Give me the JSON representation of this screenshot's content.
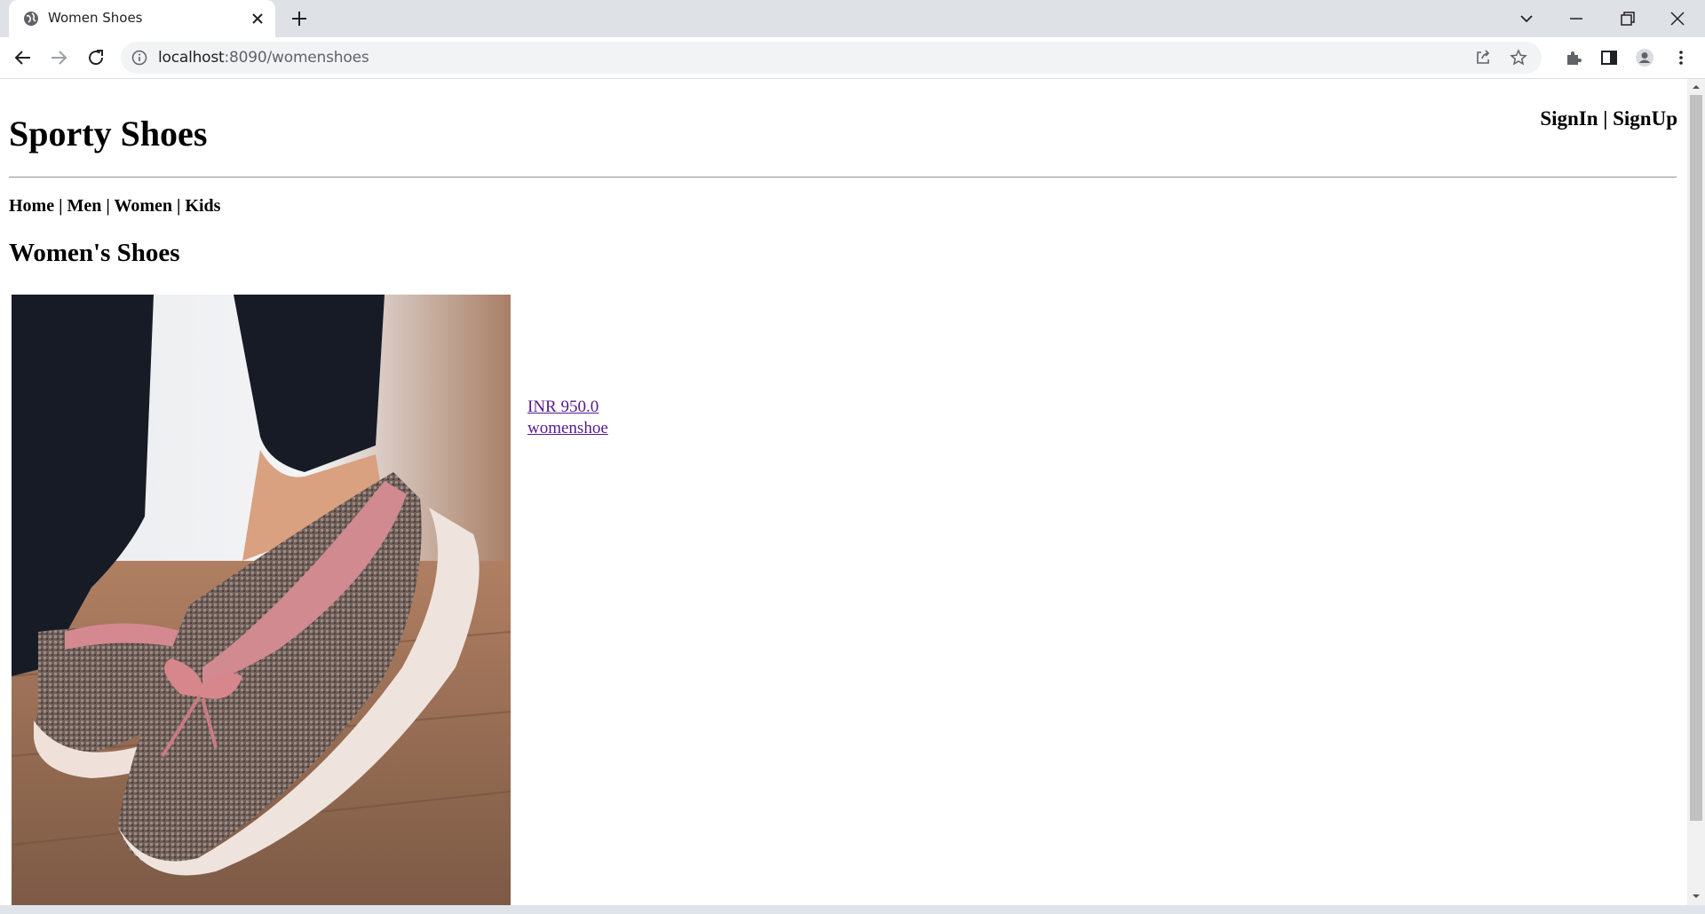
{
  "browser": {
    "tab_title": "Women Shoes",
    "url_host": "localhost",
    "url_path": ":8090/womenshoes"
  },
  "header": {
    "brand": "Sporty Shoes",
    "auth": {
      "signin": "SignIn",
      "separator": "|",
      "signup": "SignUp"
    }
  },
  "nav": {
    "items": [
      "Home",
      "Men",
      "Women",
      "Kids"
    ],
    "separator": "|"
  },
  "section": {
    "title": "Women's Shoes"
  },
  "product": {
    "price": "INR 950.0",
    "name": "womenshoe"
  },
  "colors": {
    "link_visited": "#551a8b",
    "chrome_tabstrip": "#dee1e6",
    "omnibox": "#f1f3f4"
  }
}
